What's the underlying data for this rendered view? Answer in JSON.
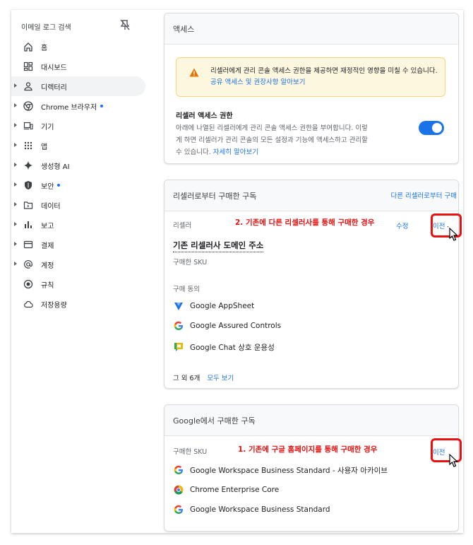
{
  "sidebar": {
    "header": "이메일 로그 검색",
    "items": [
      {
        "label": "홈",
        "icon": "home-icon",
        "arrow": false,
        "dot": false
      },
      {
        "label": "대시보드",
        "icon": "dashboard-icon",
        "arrow": false,
        "dot": false
      },
      {
        "label": "디렉터리",
        "icon": "person-icon",
        "arrow": true,
        "dot": false,
        "active": true
      },
      {
        "label": "Chrome 브라우저",
        "icon": "chrome-icon",
        "arrow": true,
        "dot": true
      },
      {
        "label": "기기",
        "icon": "devices-icon",
        "arrow": true,
        "dot": false
      },
      {
        "label": "앱",
        "icon": "apps-grid-icon",
        "arrow": true,
        "dot": false
      },
      {
        "label": "생성형 AI",
        "icon": "sparkle-icon",
        "arrow": true,
        "dot": false
      },
      {
        "label": "보안",
        "icon": "shield-icon",
        "arrow": true,
        "dot": true
      },
      {
        "label": "데이터",
        "icon": "folder-icon",
        "arrow": true,
        "dot": false
      },
      {
        "label": "보고",
        "icon": "bar-chart-icon",
        "arrow": true,
        "dot": false
      },
      {
        "label": "결제",
        "icon": "credit-card-icon",
        "arrow": true,
        "dot": false
      },
      {
        "label": "계정",
        "icon": "at-sign-icon",
        "arrow": true,
        "dot": false
      },
      {
        "label": "규칙",
        "icon": "rules-icon",
        "arrow": false,
        "dot": false
      },
      {
        "label": "저장용량",
        "icon": "cloud-icon",
        "arrow": false,
        "dot": false
      }
    ]
  },
  "access": {
    "title": "액세스",
    "warning_text": "리셀러에게 관리 콘솔 액세스 권한을 제공하면 재정적인 영향을 미칠 수 있습니다.",
    "warning_link": "공유 액세스 및 권장사항 알아보기",
    "perm_title": "리셀러 액세스 권한",
    "perm_desc": "아래에 나열된 리셀러에게 관리 콘솔 액세스 권한을 부여합니다. 이렇게 하면 리셀러가 관리 콘솔의 모든 설정과 기능에 액세스하고 관리할 수 있습니다.",
    "perm_link": "자세히 알아보기",
    "toggle_on": true
  },
  "reseller": {
    "title": "리셀러로부터 구매한 구독",
    "head_link": "다른 리셀러로부터 구매",
    "reseller_label": "리셀러",
    "annotation": "2. 기존에 다른 리셀러사를 통해 구매한 경우",
    "edit": "수정",
    "transfer": "이전",
    "domain": "기존 리셀러사 도메인 주소",
    "sku_label": "구매한 SKU",
    "consent_label": "구매 동의",
    "products": [
      {
        "name": "Google AppSheet",
        "icon": "appsheet-icon"
      },
      {
        "name": "Google Assured Controls",
        "icon": "google-g-icon"
      },
      {
        "name": "Google Chat 상호 운용성",
        "icon": "google-chat-icon"
      }
    ],
    "more_text": "그 외 6개",
    "more_link": "모두 보기"
  },
  "google": {
    "title": "Google에서 구매한 구독",
    "sku_label": "구매한 SKU",
    "annotation": "1. 기존에 구글 홈페이지를 통해 구매한 경우",
    "transfer": "이전",
    "products": [
      {
        "name": "Google Workspace Business Standard - 사용자 아카이브",
        "icon": "google-g-icon"
      },
      {
        "name": "Chrome Enterprise Core",
        "icon": "chrome-icon"
      },
      {
        "name": "Google Workspace Business Standard",
        "icon": "google-g-icon"
      }
    ]
  },
  "colors": {
    "accent": "#1a73e8",
    "annotation_red": "#e8110f",
    "warning_bg": "#fef7e0"
  }
}
